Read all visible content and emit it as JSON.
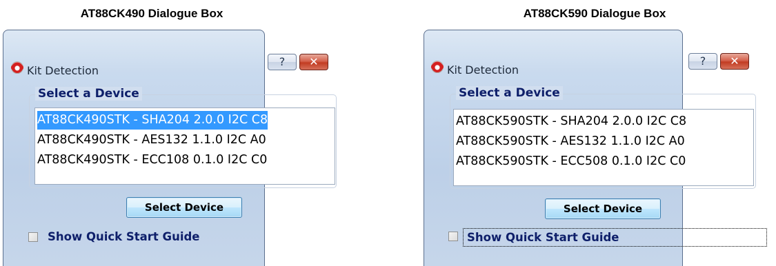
{
  "captions": {
    "left": "AT88CK490 Dialogue Box",
    "right": "AT88CK590 Dialogue Box"
  },
  "dialogs": [
    {
      "title": "Kit Detection",
      "help_label": "?",
      "close_label": "✕",
      "group_title": "Select a Device",
      "items": [
        "AT88CK490STK - SHA204 2.0.0 I2C C8",
        "AT88CK490STK - AES132 1.1.0 I2C A0",
        "AT88CK490STK - ECC108 0.1.0 I2C C0"
      ],
      "selected_index": 0,
      "select_button": "Select Device",
      "checkbox_label": "Show Quick Start Guide",
      "checkbox_checked": false,
      "checkbox_focused": false
    },
    {
      "title": "Kit Detection",
      "help_label": "?",
      "close_label": "✕",
      "group_title": "Select a Device",
      "items": [
        "AT88CK590STK - SHA204 2.0.0 I2C C8",
        "AT88CK590STK - AES132 1.1.0 I2C A0",
        "AT88CK590STK - ECC508 0.1.0 I2C C0"
      ],
      "selected_index": null,
      "select_button": "Select Device",
      "checkbox_label": "Show Quick Start Guide",
      "checkbox_checked": false,
      "checkbox_focused": true
    }
  ],
  "colors": {
    "selection": "#3399ff",
    "group_title": "#0e1f6a",
    "close_button": "#c23c22"
  },
  "icons": {
    "app": "kit-detection-app-icon",
    "help": "help-icon",
    "close": "close-icon"
  }
}
